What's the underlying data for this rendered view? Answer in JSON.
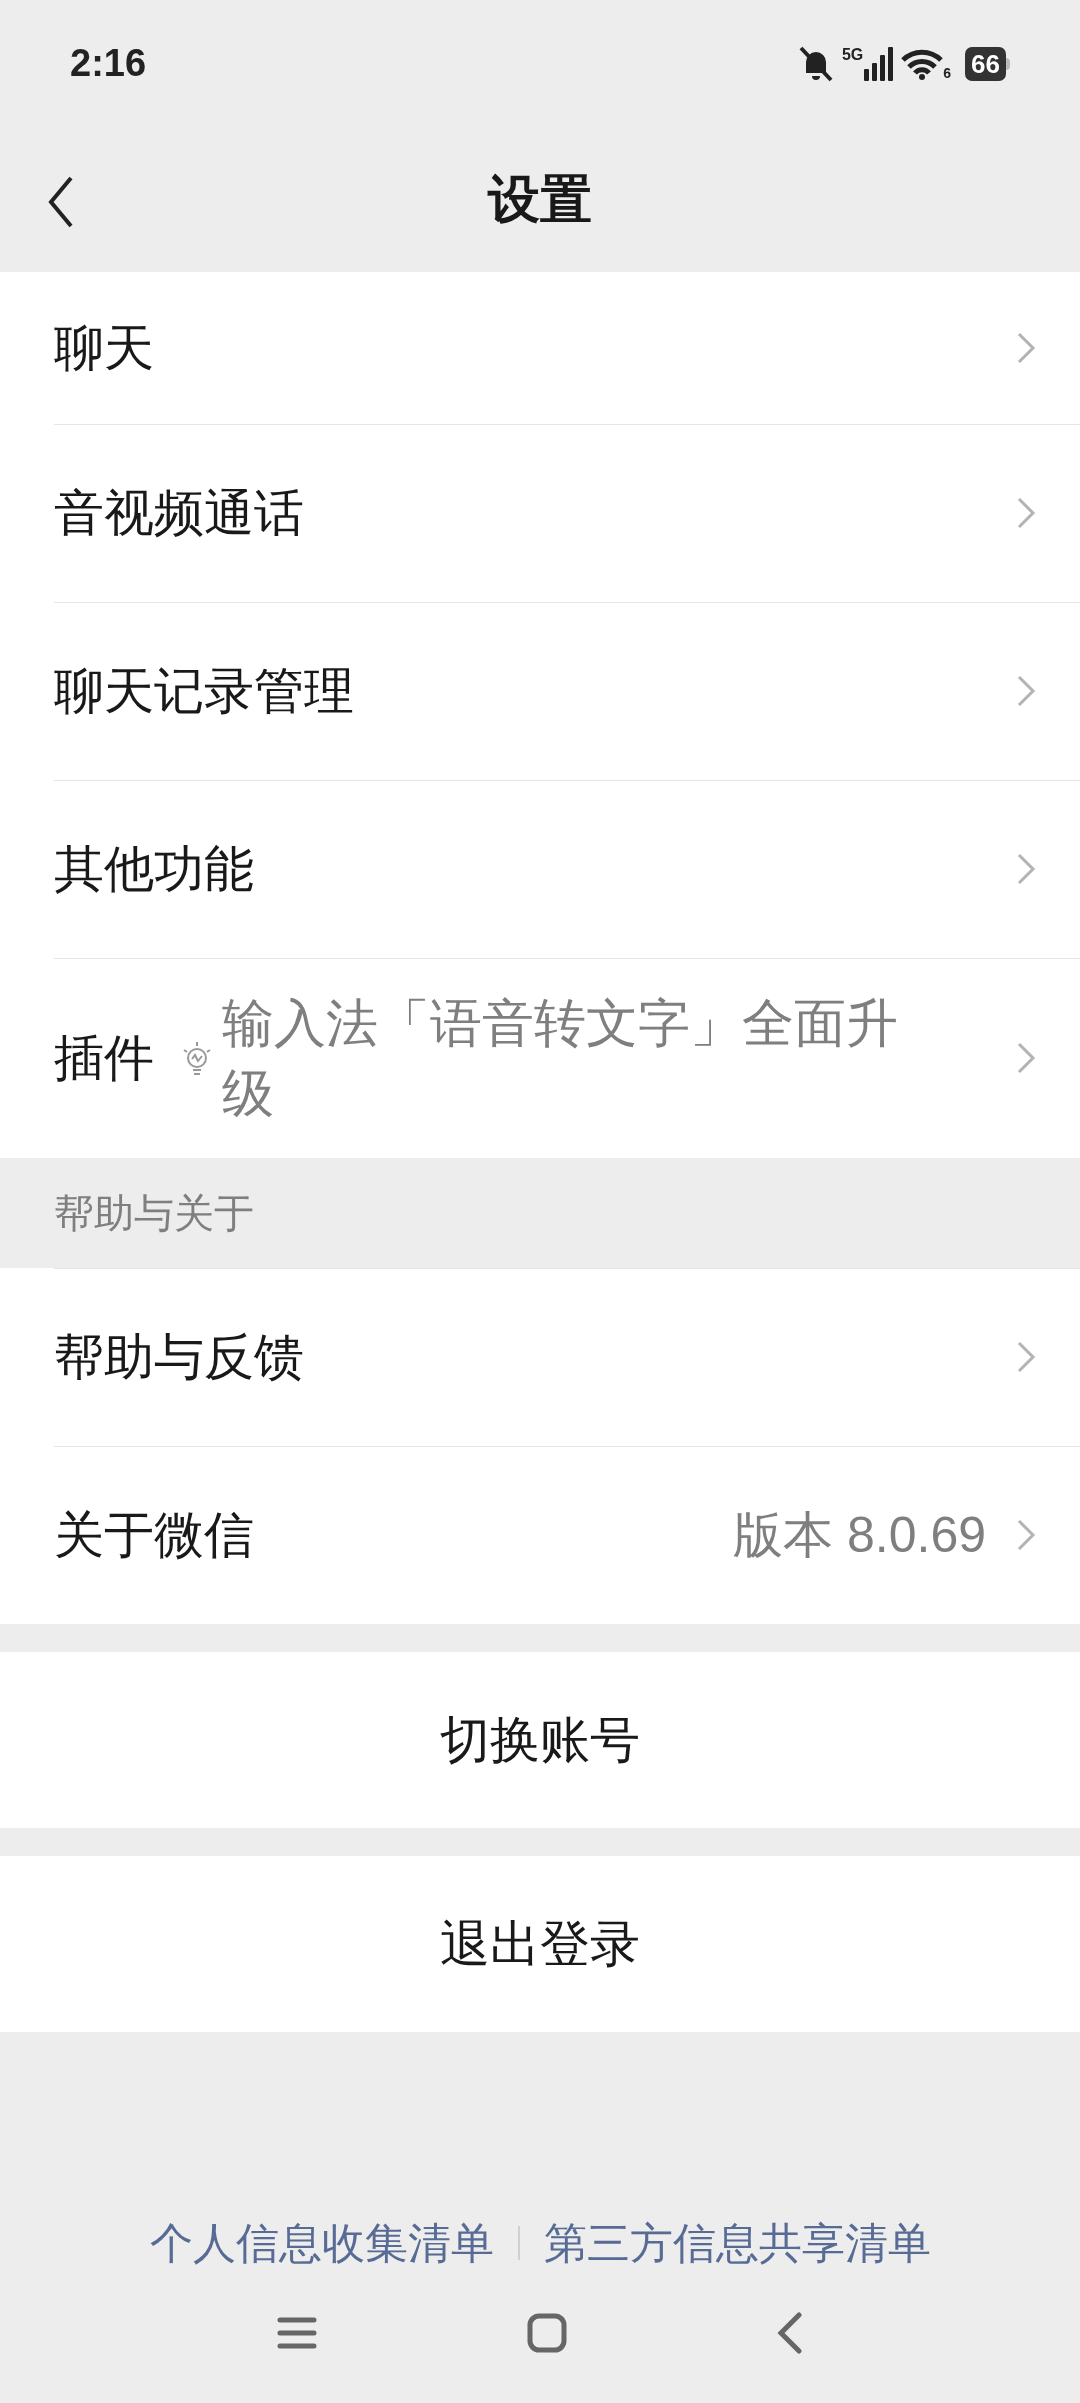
{
  "status_bar": {
    "time": "2:16",
    "network": "5G",
    "wifi_badge": "6",
    "battery": "66"
  },
  "header": {
    "title": "设置"
  },
  "rows": [
    {
      "kind": "plain",
      "label": "聊天"
    },
    {
      "kind": "plain",
      "label": "音视频通话"
    },
    {
      "kind": "plain",
      "label": "聊天记录管理"
    },
    {
      "kind": "plain",
      "label": "其他功能"
    },
    {
      "kind": "note",
      "label": "插件",
      "note": "输入法「语音转文字」全面升级"
    }
  ],
  "help_section": {
    "heading": "帮助与关于",
    "rows": [
      {
        "kind": "plain",
        "label": "帮助与反馈"
      },
      {
        "kind": "value",
        "label": "关于微信",
        "value": "版本 8.0.69"
      }
    ]
  },
  "actions": [
    "切换账号",
    "退出登录"
  ],
  "footer_links": [
    "个人信息收集清单",
    "第三方信息共享清单"
  ]
}
